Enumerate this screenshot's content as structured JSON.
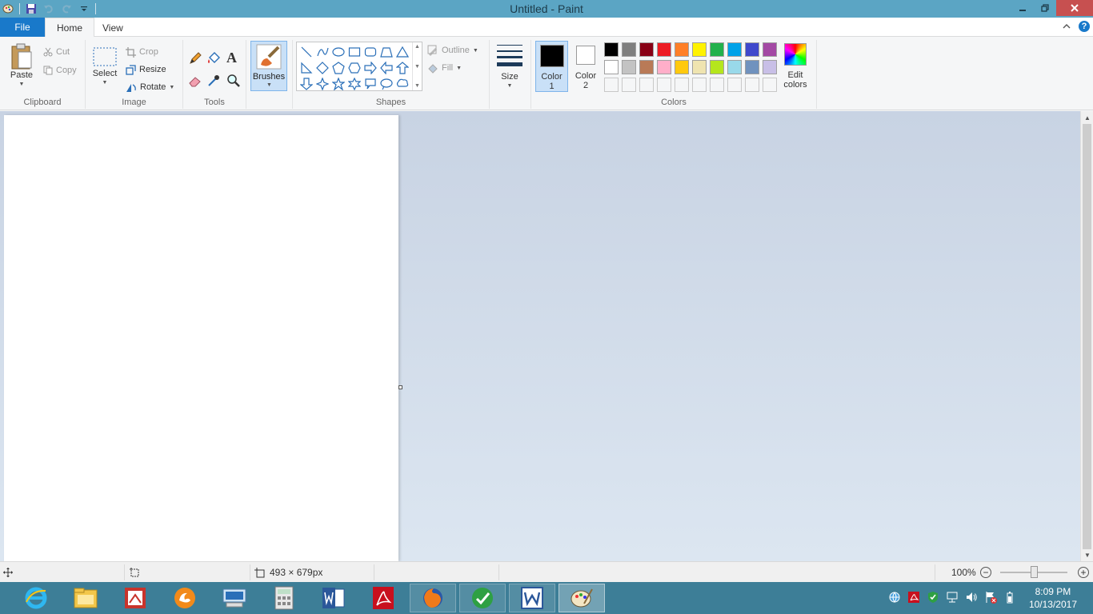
{
  "window": {
    "title": "Untitled - Paint"
  },
  "tabs": {
    "file": "File",
    "home": "Home",
    "view": "View"
  },
  "clipboard": {
    "paste": "Paste",
    "cut": "Cut",
    "copy": "Copy",
    "label": "Clipboard"
  },
  "image": {
    "select": "Select",
    "crop": "Crop",
    "resize": "Resize",
    "rotate": "Rotate",
    "label": "Image"
  },
  "tools": {
    "label": "Tools",
    "text_glyph": "A"
  },
  "brushes": {
    "label": "Brushes"
  },
  "shapes": {
    "outline": "Outline",
    "fill": "Fill",
    "label": "Shapes"
  },
  "size": {
    "label": "Size"
  },
  "colors": {
    "color1_line1": "Color",
    "color1_line2": "1",
    "color2_line1": "Color",
    "color2_line2": "2",
    "edit_line1": "Edit",
    "edit_line2": "colors",
    "label": "Colors",
    "color1_value": "#000000",
    "color2_value": "#ffffff",
    "palette": [
      "#000000",
      "#7f7f7f",
      "#880015",
      "#ed1c24",
      "#ff7f27",
      "#fff200",
      "#22b14c",
      "#00a2e8",
      "#3f48cc",
      "#a349a4",
      "#ffffff",
      "#c3c3c3",
      "#b97a57",
      "#ffaec9",
      "#ffc90e",
      "#efe4b0",
      "#b5e61d",
      "#99d9ea",
      "#7092be",
      "#c8bfe7",
      "",
      "",
      "",
      "",
      "",
      "",
      "",
      "",
      "",
      ""
    ]
  },
  "status": {
    "dimensions": "493 × 679px",
    "zoom": "100%",
    "zoom_level": 1.0
  },
  "clock": {
    "time": "8:09 PM",
    "date": "10/13/2017"
  }
}
